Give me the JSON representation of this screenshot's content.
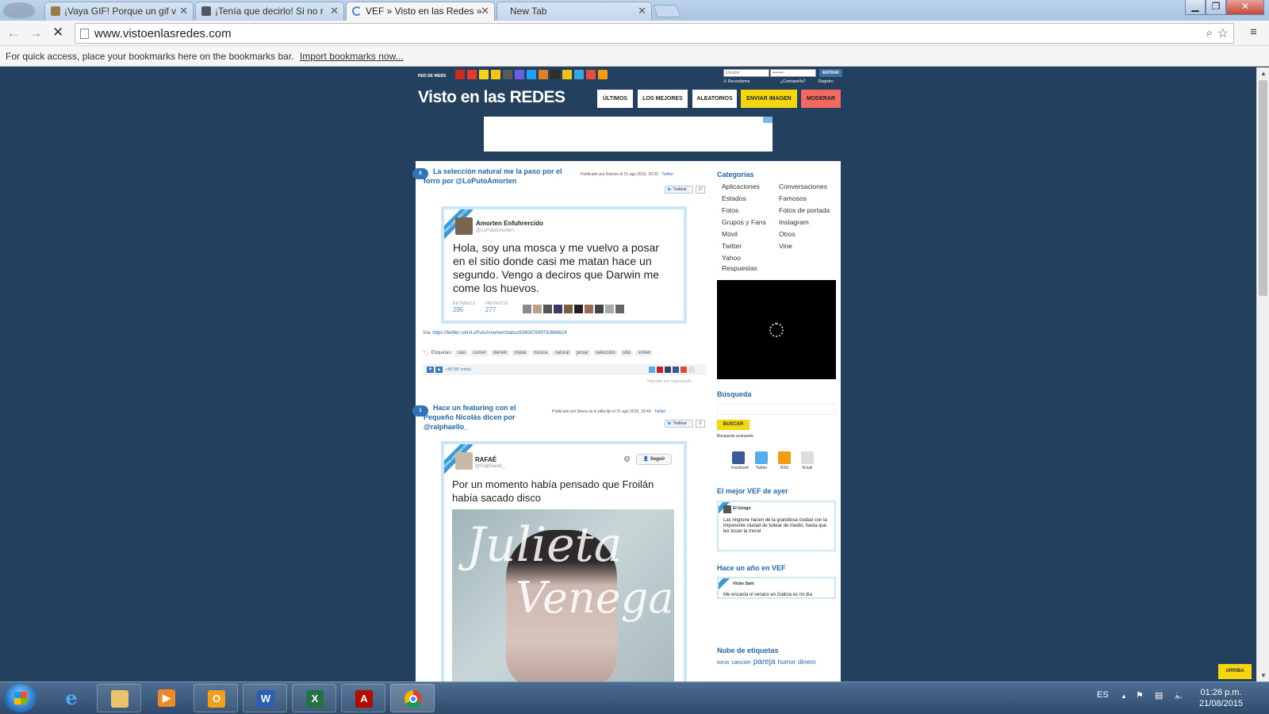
{
  "browser": {
    "tabs": [
      {
        "title": "¡Vaya GIF! Porque un gif v"
      },
      {
        "title": "¡Tenía que decirlo! Si no r"
      },
      {
        "title": "VEF » Visto en las Redes »"
      },
      {
        "title": "New Tab"
      }
    ],
    "url": "www.vistoenlasredes.com",
    "bookmarks_message": "For quick access, place your bookmarks here on the bookmarks bar.",
    "bookmarks_link": "Import bookmarks now..."
  },
  "site": {
    "network_label": "RED DE WEBS",
    "network_colors": [
      "#c62d1f",
      "#e7392b",
      "#f4d31a",
      "#f5c518",
      "#5a5a5a",
      "#6c5ce7",
      "#1da1f2",
      "#e67e22",
      "#2d2d2d",
      "#f1c40f",
      "#3ba5e0",
      "#e74c3c",
      "#f39c12"
    ],
    "login": {
      "user_placeholder": "Usuario",
      "pass_placeholder": "••••••••",
      "enter_label": "ENTRAR",
      "remember": "Recordarme",
      "forgot": "¿Contraseña?",
      "register": "Registro"
    },
    "brand": "Visto en las REDES",
    "menu": [
      {
        "label": "ÚLTIMOS",
        "bg": "#ffffff"
      },
      {
        "label": "LOS MEJORES",
        "bg": "#ffffff"
      },
      {
        "label": "ALEATORIOS",
        "bg": "#ffffff"
      },
      {
        "label": "ENVIAR IMAGEN",
        "bg": "#f5d60f"
      },
      {
        "label": "MODERAR",
        "bg": "#f26a5f"
      }
    ]
  },
  "posts": [
    {
      "number": "0",
      "title_line1": "La selección natural me la paso por el",
      "title_line2": "forro por @LoPutoAmorten",
      "meta_prefix": "Publicado por Ramiro el 21 ago 2015, 20:00 ·",
      "meta_source": "Twitter",
      "tweet_btn": "Twittear",
      "tweet_count": "37",
      "tweet": {
        "ribbon": "VISTOENLASREDES.COM",
        "name": "Amorten Enfuhrercido",
        "handle": "@LoPutoAmorten",
        "text_lines": [
          "Hola, soy una mosca y me vuelvo a posar",
          "en el sitio donde casi me matan hace un",
          "segundo. Vengo a deciros que Darwin me",
          "come los huevos."
        ],
        "retweets_label": "RETWEETS",
        "retweets": "295",
        "favorites_label": "FAVORITOS",
        "favorites": "277"
      },
      "via_label": "Vía:",
      "via_url": "https://twitter.com/LoPutoAmorten/status/634087699792666624",
      "tags_label": "Etiquetas:",
      "tags": [
        "casi",
        "comer",
        "darwin",
        "matar",
        "mosca",
        "natural",
        "posar",
        "seleccion",
        "sitio",
        "volver"
      ],
      "votes": "+80 (80 votos)",
      "report": "Reportar por inapropiado"
    },
    {
      "number": "1",
      "title_line1": "Hace un featuring con el",
      "title_line2": "Pequeño Nicolás dicen por",
      "title_line3": "@ralphaello_",
      "meta_prefix": "Publicado por Elena se lo pilla fijo el 21 ago 2015, 19:40 ·",
      "meta_source": "Twitter",
      "tweet_btn": "Twittear",
      "tweet_count": "5",
      "tweet": {
        "ribbon": "VISTOENLASREDES.COM",
        "name": "RAFAÉ",
        "handle": "@Ralphaello_",
        "follow": "Seguir",
        "text_lines": [
          "Por un momento había pensado que Froilán",
          "había sacado disco"
        ]
      }
    }
  ],
  "sidebar": {
    "categories_title": "Categorías",
    "categories_left": [
      "Aplicaciones",
      "Estados",
      "Fotos",
      "Grupos y Fans",
      "Móvil",
      "Twitter",
      "Yahoo",
      "Respuestas"
    ],
    "categories_right": [
      "Conversaciones",
      "Famosos",
      "Fotos de portada",
      "Instagram",
      "Otros",
      "Vine"
    ],
    "search_title": "Búsqueda",
    "search_btn": "BUSCAR",
    "advanced_search": "Búsqueda avanzada",
    "follow": [
      {
        "label": "Facebook",
        "color": "#3b5998",
        "icon": "facebook-icon"
      },
      {
        "label": "Twitter",
        "color": "#55acee",
        "icon": "twitter-icon"
      },
      {
        "label": "RSS",
        "color": "#f39c12",
        "icon": "rss-icon"
      },
      {
        "label": "Email",
        "color": "#dddddd",
        "icon": "email-icon"
      }
    ],
    "best_title": "El mejor VEF de ayer",
    "best_name": "El Gringo",
    "best_text": "Las ringtone hacen de la grandiosa ciudad con la imponente ciudad de tuitear de medio, hasta que les tocan la moral",
    "year_title": "Hace un año en VEF",
    "year_name": "Víctor Sant",
    "year_text": "Me encanta el verano en Galicia es mi día",
    "tagcloud_title": "Nube de etiquetas",
    "tagcloud": [
      {
        "t": "toros",
        "s": "sm"
      },
      {
        "t": "canción",
        "s": "sm"
      },
      {
        "t": "pareja",
        "s": "lg"
      },
      {
        "t": "humor",
        "s": "md"
      },
      {
        "t": "dinero",
        "s": "md"
      }
    ]
  },
  "arriba": "ARRIBA",
  "taskbar": {
    "lang": "ES",
    "time": "01:26 p.m.",
    "date": "21/08/2015"
  }
}
